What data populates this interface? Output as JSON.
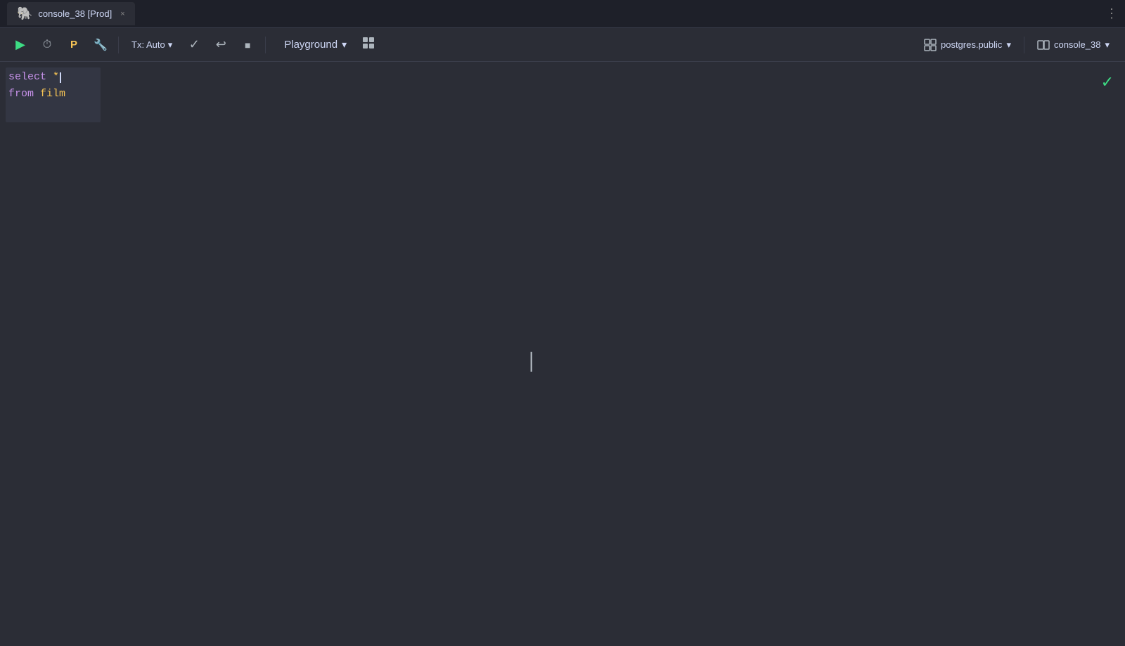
{
  "titlebar": {
    "tab_name": "console_38 [Prod]",
    "tab_close": "×",
    "menu_dots": "⋮"
  },
  "toolbar": {
    "run_label": "▶",
    "history_label": "⟳",
    "bookmark_label": "P",
    "wrench_label": "🔧",
    "tx_label": "Tx: Auto",
    "tx_chevron": "▾",
    "check_label": "✓",
    "undo_label": "↩",
    "stop_label": "■",
    "playground_label": "Playground",
    "playground_chevron": "▾",
    "grid_label": "☰",
    "schema_label": "postgres.public",
    "schema_chevron": "▾",
    "console_label": "console_38",
    "console_chevron": "▾"
  },
  "editor": {
    "line1_keyword": "select",
    "line1_star": " *",
    "line2_from": "from",
    "line2_table": " film"
  },
  "colors": {
    "run_green": "#3ddc84",
    "check_green": "#3ddc84",
    "bg_dark": "#1e2029",
    "bg_editor": "#2b2d36",
    "keyword_purple": "#c792ea",
    "value_yellow": "#f8c555",
    "elephant_blue": "#336791"
  }
}
